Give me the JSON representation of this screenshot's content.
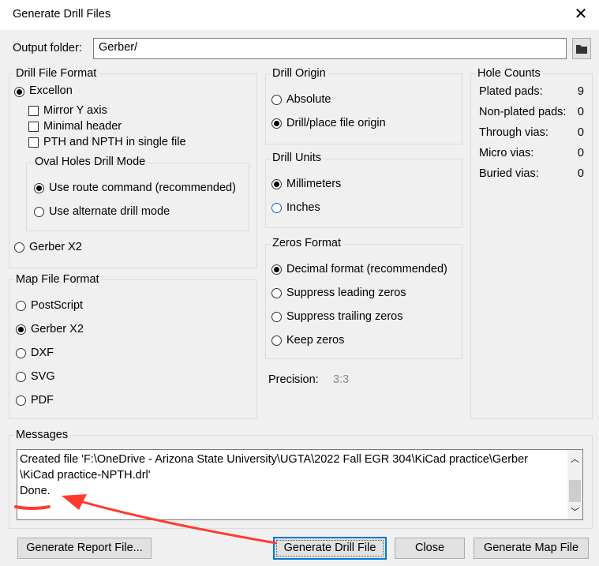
{
  "window": {
    "title": "Generate Drill Files",
    "close_glyph": "✕"
  },
  "output": {
    "label": "Output folder:",
    "value": "Gerber/"
  },
  "drill_format": {
    "label": "Drill File Format",
    "excellon": "Excellon",
    "mirror_y": "Mirror Y axis",
    "minimal_header": "Minimal header",
    "pth_npth": "PTH and NPTH in single file",
    "oval": {
      "label": "Oval Holes Drill Mode",
      "route": "Use route command (recommended)",
      "alternate": "Use alternate drill mode"
    },
    "gerber_x2": "Gerber X2"
  },
  "map_format": {
    "label": "Map File Format",
    "options": [
      "PostScript",
      "Gerber X2",
      "DXF",
      "SVG",
      "PDF"
    ],
    "selected": "Gerber X2"
  },
  "drill_origin": {
    "label": "Drill Origin",
    "absolute": "Absolute",
    "aux": "Drill/place file origin"
  },
  "drill_units": {
    "label": "Drill Units",
    "mm": "Millimeters",
    "inches": "Inches"
  },
  "zeros": {
    "label": "Zeros Format",
    "decimal": "Decimal format (recommended)",
    "leading": "Suppress leading zeros",
    "trailing": "Suppress trailing zeros",
    "keep": "Keep zeros"
  },
  "precision": {
    "label": "Precision:",
    "value": "3:3"
  },
  "hole_counts": {
    "label": "Hole Counts",
    "rows": [
      {
        "name": "Plated pads:",
        "value": "9"
      },
      {
        "name": "Non-plated pads:",
        "value": "0"
      },
      {
        "name": "Through vias:",
        "value": "0"
      },
      {
        "name": "Micro vias:",
        "value": "0"
      },
      {
        "name": "Buried vias:",
        "value": "0"
      }
    ]
  },
  "messages": {
    "label": "Messages",
    "lines": [
      "Created file 'F:\\OneDrive - Arizona State University\\UGTA\\2022 Fall EGR 304\\KiCad practice\\Gerber",
      "\\KiCad practice-NPTH.drl'",
      "Done."
    ]
  },
  "buttons": {
    "report": "Generate Report File...",
    "drill": "Generate Drill File",
    "close": "Close",
    "map": "Generate Map File"
  },
  "annotation": {
    "color": "#ff3b30"
  }
}
